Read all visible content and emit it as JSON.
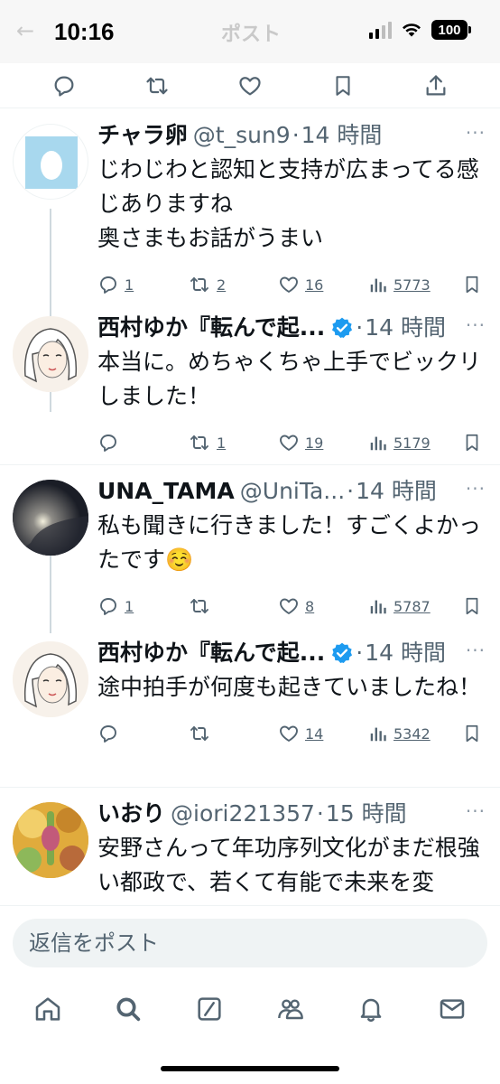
{
  "status_bar": {
    "time": "10:16",
    "battery": "100",
    "ghost_title": "ポスト",
    "ghost_back": "←"
  },
  "action_bar": {
    "icons": [
      "reply-icon",
      "retweet-icon",
      "like-icon",
      "bookmark-icon",
      "share-icon"
    ]
  },
  "tweets": [
    {
      "name": "チャラ卵",
      "handle": "@t_sun9",
      "dot": "·",
      "time": "14 時間",
      "body": "じわじわと認知と支持が広まってる感じありますね\n奥さまもお話がうまい",
      "replies": "1",
      "retweets": "2",
      "likes": "16",
      "views": "5773",
      "more": "···"
    },
    {
      "name": "西村ゆか『転んで起...",
      "handle": "",
      "dot": "·",
      "time": "14 時間",
      "verified": true,
      "body": "本当に。めちゃくちゃ上手でビックリしました！",
      "replies": "",
      "retweets": "1",
      "likes": "19",
      "views": "5179",
      "more": "···"
    },
    {
      "name": "UNA_TAMA",
      "handle": "@UniTa...",
      "dot": "·",
      "time": "14 時間",
      "body": "私も聞きに行きました！すごくよかったです☺️",
      "replies": "1",
      "retweets": "",
      "likes": "8",
      "views": "5787",
      "more": "···"
    },
    {
      "name": "西村ゆか『転んで起...",
      "handle": "",
      "dot": "·",
      "time": "14 時間",
      "verified": true,
      "body": "途中拍手が何度も起きていましたね！",
      "replies": "",
      "retweets": "",
      "likes": "14",
      "views": "5342",
      "more": "···"
    },
    {
      "name": "いおり",
      "handle": "@iori221357",
      "dot": "·",
      "time": "15 時間",
      "body": "安野さんって年功序列文化がまだ根強い都政で、若くて有能で未来を変",
      "more": "···"
    }
  ],
  "reply_bar": {
    "placeholder": "返信をポスト"
  },
  "bottom_nav": {
    "icons": [
      "home-icon",
      "search-icon",
      "grok-icon",
      "communities-icon",
      "notifications-icon",
      "messages-icon"
    ]
  },
  "colors": {
    "text_primary": "#0f1419",
    "text_secondary": "#536471",
    "verified_blue": "#1d9bf0",
    "divider": "#eff3f4"
  }
}
